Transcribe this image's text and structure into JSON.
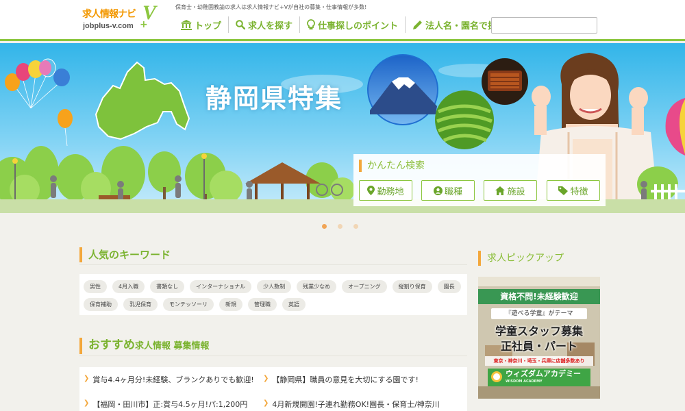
{
  "header": {
    "logo": {
      "main": "求人情報ナビ",
      "v": "V",
      "plus": "+",
      "url": "jobplus-v.com"
    },
    "tagline": "保育士・幼稚園教諭の求人は求人情報ナビ+Vが自社の募集・仕事情報が多数!",
    "nav": [
      {
        "label": "トップ",
        "icon": "building-icon"
      },
      {
        "label": "求人を探す",
        "icon": "search-icon"
      },
      {
        "label": "仕事探しのポイント",
        "icon": "lightbulb-icon"
      },
      {
        "label": "法人名・園名で探す",
        "icon": "pencil-icon"
      }
    ],
    "search": {
      "placeholder": "",
      "value": ""
    }
  },
  "hero": {
    "title": "静岡県特集",
    "quick_search": {
      "title": "かんたん検索",
      "buttons": [
        {
          "label": "勤務地",
          "icon": "map-pin-icon"
        },
        {
          "label": "職種",
          "icon": "person-icon"
        },
        {
          "label": "施設",
          "icon": "home-icon"
        },
        {
          "label": "特徴",
          "icon": "tag-icon"
        }
      ]
    },
    "slides": 3,
    "active_slide": 1
  },
  "keywords": {
    "heading": "人気のキーワード",
    "rows": [
      [
        "男性",
        "4月入職",
        "書類なし",
        "インターナショナル",
        "少人数制",
        "残業少なめ",
        "オープニング",
        "縦割り保育",
        "園長"
      ],
      [
        "保育補助",
        "乳児保育",
        "モンテッソーリ",
        "新規",
        "管理職",
        "英語"
      ]
    ]
  },
  "recommend": {
    "heading_big": "おすすめ",
    "heading_small": "求人情報 募集情報",
    "items": [
      [
        "賞与4.4ヶ月分!未経験、ブランクありでも歓迎!",
        "【静岡県】職員の意見を大切にする園です!"
      ],
      [
        "【福岡・田川市】正:賞与4.5ヶ月!パ:1,200円",
        "4月新規開園!子連れ勤務OK!園長・保育士/神奈川"
      ]
    ]
  },
  "pickup": {
    "heading": "求人ピックアップ",
    "banner": {
      "top": "資格不問!未経験歓迎",
      "sub": "『遊べる学童』がテーマ",
      "main1": "学童スタッフ募集",
      "main2": "正社員・パート",
      "area": "東京・神奈川・埼玉・兵庫に店舗多数あり",
      "logo": "ウィズダムアカデミー",
      "logo_en": "WISDOM ACADEMY"
    }
  },
  "colors": {
    "brand_green": "#8cc63f",
    "accent_orange": "#f3a73b",
    "sky": "#32b5e9"
  }
}
